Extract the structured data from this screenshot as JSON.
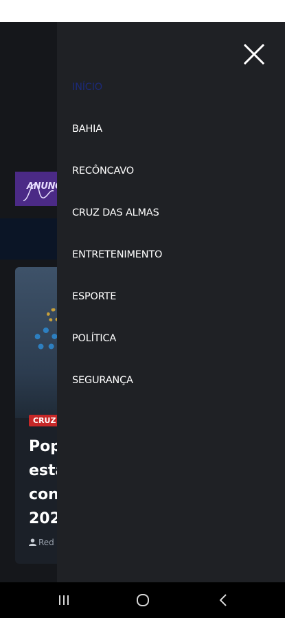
{
  "background_page": {
    "ad_banner_text": "ANUNC",
    "card": {
      "category_badge": "CRUZ",
      "headline_lines": [
        "Pop",
        "esta",
        "con",
        "202"
      ],
      "author": "Red"
    }
  },
  "drawer": {
    "close_icon": "close-icon",
    "menu_items": [
      {
        "label": "INÍCIO",
        "active": true
      },
      {
        "label": "BAHIA",
        "active": false
      },
      {
        "label": "RECÔNCAVO",
        "active": false
      },
      {
        "label": "CRUZ DAS ALMAS",
        "active": false
      },
      {
        "label": "ENTRETENIMENTO",
        "active": false
      },
      {
        "label": "ESPORTE",
        "active": false
      },
      {
        "label": "POLÍTICA",
        "active": false
      },
      {
        "label": "SEGURANÇA",
        "active": false
      }
    ]
  },
  "system_nav": {
    "recents_icon": "recents-icon",
    "home_icon": "home-icon",
    "back_icon": "back-icon"
  },
  "colors": {
    "drawer_bg": "#1f2125",
    "active_item": "#1c2a78",
    "menu_text": "#ffffff",
    "badge_red": "#c62828"
  }
}
